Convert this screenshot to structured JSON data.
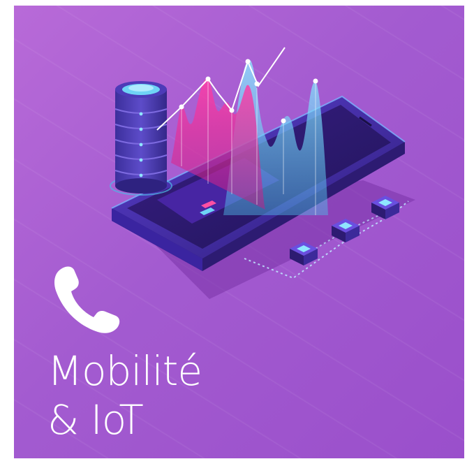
{
  "tile": {
    "background_colors": [
      "#b86ad8",
      "#9a4fcb"
    ],
    "title_line_1": "Mobilité",
    "title_line_2": "& IoT"
  },
  "icons": {
    "phone": "phone-handset-icon",
    "database": "database-stack-icon",
    "chart": "area-chart-icon",
    "device": "tablet-device-icon",
    "nodes": "iot-node-icon"
  },
  "accent_colors": {
    "magenta": "#e0359a",
    "cyan": "#6fd3f5",
    "deep_blue": "#2a1a6b"
  }
}
